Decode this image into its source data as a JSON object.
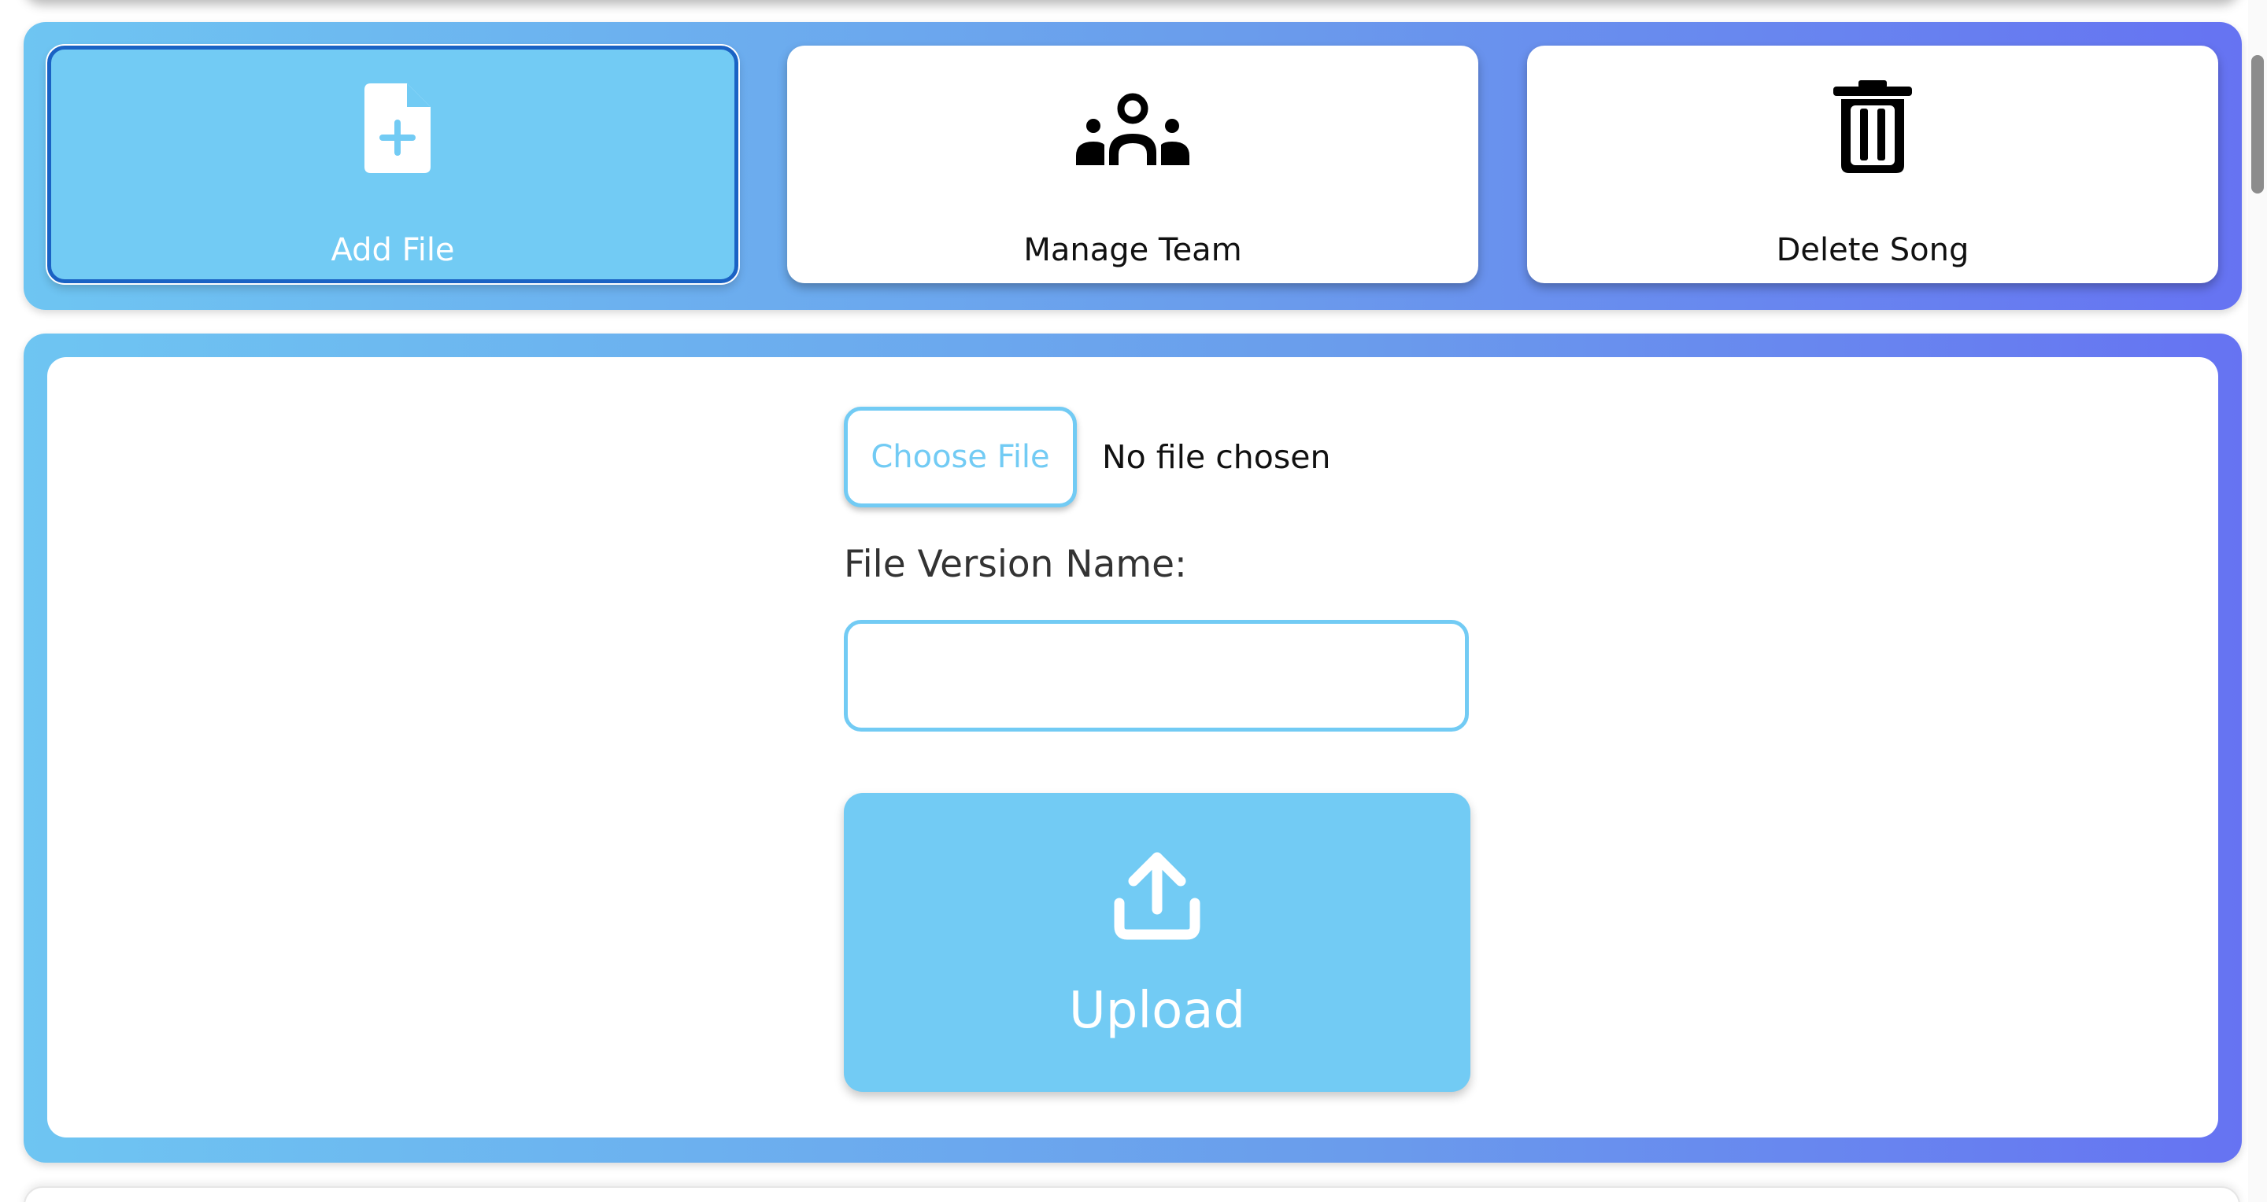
{
  "toolbar": {
    "items": [
      {
        "label": "Add File",
        "icon": "file-plus-icon",
        "active": true
      },
      {
        "label": "Manage Team",
        "icon": "team-icon",
        "active": false
      },
      {
        "label": "Delete Song",
        "icon": "trash-icon",
        "active": false
      }
    ]
  },
  "upload_form": {
    "choose_file_label": "Choose File",
    "file_status": "No file chosen",
    "version_name_label": "File Version Name:",
    "version_name_value": "",
    "version_name_placeholder": "",
    "upload_label": "Upload",
    "upload_icon": "upload-icon"
  },
  "colors": {
    "accent": "#72cbf4",
    "active_border": "#1a62c4",
    "gradient_start": "#6ec5f2",
    "gradient_end": "#6673f2"
  }
}
